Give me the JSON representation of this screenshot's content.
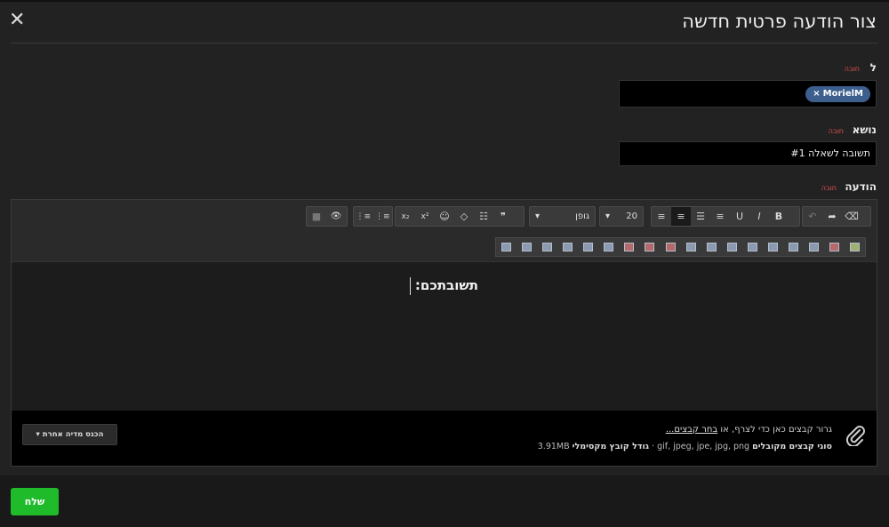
{
  "dialog": {
    "title": "צור הודעה פרטית חדשה",
    "close_label": "✕"
  },
  "form": {
    "to_label": "ל",
    "subject_label": "נושא",
    "message_label": "הודעה",
    "required": "חובה",
    "recipients": [
      {
        "name": "MorielM",
        "remove": "×"
      }
    ],
    "subject_value": "תשובה לשאלה #1"
  },
  "toolbar": {
    "font_name": "גופן",
    "font_size": "20",
    "dropdown_caret": "▾",
    "buttons": {
      "clear": "⌫",
      "redo": "➦",
      "undo": "↶",
      "bold": "B",
      "italic": "I",
      "underline": "U",
      "align_right": "≡",
      "justify": "☰",
      "align_center": "≡",
      "align_left": "≡",
      "quote": "❞",
      "bbcode": "☷",
      "code": "◇",
      "smilie": "☺",
      "subscript": "x₂",
      "superscript": "x²",
      "list_ordered": "⋮≡",
      "list_bullet": "⋮≡",
      "preview": "👁",
      "toggle": "■"
    }
  },
  "editor": {
    "content": "תשובתכם:"
  },
  "attachments": {
    "drag_text": "גרור קבצים כאן כדי לצרף, או",
    "choose_link": "בחר קבצים...",
    "types_label": "סוגי קבצים מקובלים",
    "types_value": "gif, jpeg, jpe, jpg, png",
    "separator": "·",
    "max_label": "גודל קובץ מקסימלי",
    "max_value": "3.91MB",
    "media_button": "הכנס מדיה אחרת",
    "media_caret": "▾"
  },
  "footer": {
    "send_label": "שלח"
  },
  "colors": {
    "accent_green": "#1fbb2b",
    "chip_blue": "#3d5f8e",
    "required_red": "#e05050"
  }
}
